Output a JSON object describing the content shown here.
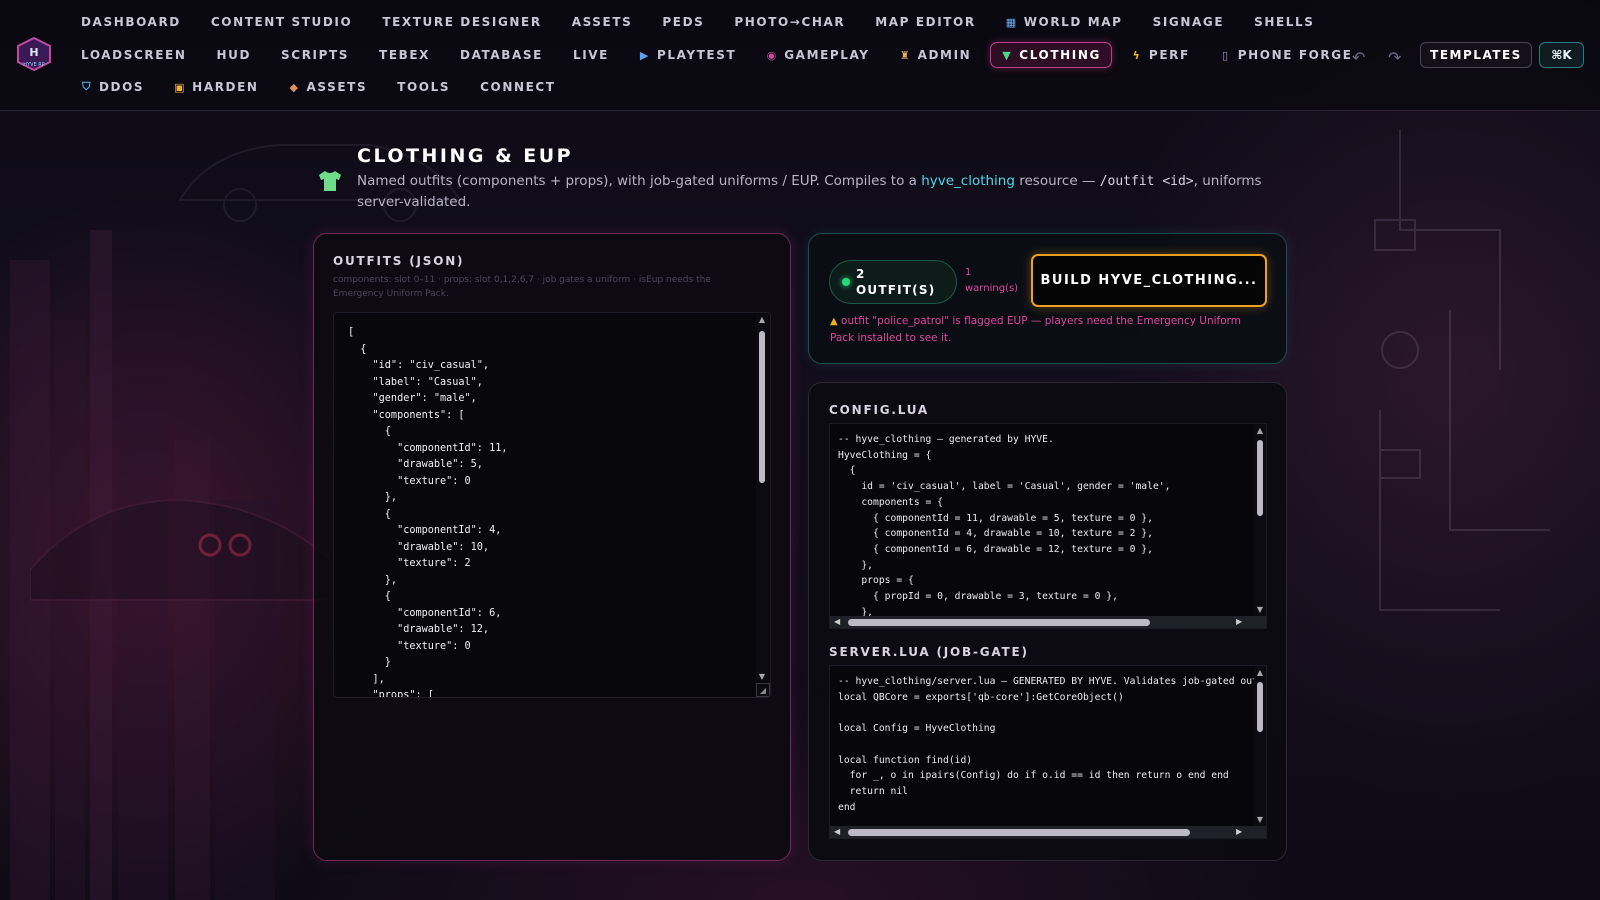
{
  "nav": {
    "logo_text": "HYVE RP",
    "row1": [
      {
        "label": "DASHBOARD",
        "icon": ""
      },
      {
        "label": "CONTENT STUDIO",
        "icon": ""
      },
      {
        "label": "TEXTURE DESIGNER",
        "icon": ""
      },
      {
        "label": "ASSETS",
        "icon": ""
      },
      {
        "label": "PEDS",
        "icon": ""
      },
      {
        "label": "PHOTO→CHAR",
        "icon": ""
      },
      {
        "label": "MAP EDITOR",
        "icon": ""
      },
      {
        "label": "WORLD MAP",
        "icon": "map-icon"
      },
      {
        "label": "SIGNAGE",
        "icon": ""
      },
      {
        "label": "SHELLS",
        "icon": ""
      }
    ],
    "row2": [
      {
        "label": "LOADSCREEN",
        "icon": ""
      },
      {
        "label": "HUD",
        "icon": ""
      },
      {
        "label": "SCRIPTS",
        "icon": ""
      },
      {
        "label": "TEBEX",
        "icon": ""
      },
      {
        "label": "DATABASE",
        "icon": ""
      },
      {
        "label": "LIVE",
        "icon": ""
      },
      {
        "label": "PLAYTEST",
        "icon": "play-icon"
      },
      {
        "label": "GAMEPLAY",
        "icon": "gameplay-icon"
      },
      {
        "label": "ADMIN",
        "icon": "admin-icon"
      },
      {
        "label": "CLOTHING",
        "icon": "shirt-icon",
        "active": true
      },
      {
        "label": "PERF",
        "icon": "lightning-icon"
      },
      {
        "label": "PHONE FORGE",
        "icon": "phone-icon"
      }
    ],
    "row3": [
      {
        "label": "DDOS",
        "icon": "shield-icon"
      },
      {
        "label": "HARDEN",
        "icon": "lock-icon"
      },
      {
        "label": "ASSETS",
        "icon": "box-icon"
      },
      {
        "label": "TOOLS",
        "icon": ""
      },
      {
        "label": "CONNECT",
        "icon": ""
      }
    ],
    "templates_label": "TEMPLATES",
    "cmdk_label": "⌘K"
  },
  "header": {
    "title": "CLOTHING & EUP",
    "desc_prefix": "Named outfits (components + props), with job-gated uniforms / EUP. Compiles to a ",
    "desc_resource": "hyve_clothing",
    "desc_middle": " resource — ",
    "desc_command": "/outfit <id>",
    "desc_suffix": ", uniforms server-validated."
  },
  "outfits": {
    "title": "OUTFITS (JSON)",
    "hint": "components: slot 0–11 · props: slot 0,1,2,6,7 · job gates a uniform · isEup needs the Emergency Uniform Pack.",
    "json": "[\n  {\n    \"id\": \"civ_casual\",\n    \"label\": \"Casual\",\n    \"gender\": \"male\",\n    \"components\": [\n      {\n        \"componentId\": 11,\n        \"drawable\": 5,\n        \"texture\": 0\n      },\n      {\n        \"componentId\": 4,\n        \"drawable\": 10,\n        \"texture\": 2\n      },\n      {\n        \"componentId\": 6,\n        \"drawable\": 12,\n        \"texture\": 0\n      }\n    ],\n    \"props\": ["
  },
  "build": {
    "count_label": "2 OUTFIT(S)",
    "warning_count": "1 warning(s)",
    "build_label": "BUILD HYVE_CLOTHING...",
    "warning_message": "outfit \"police_patrol\" is flagged EUP — players need the Emergency Uniform Pack installed to see it.",
    "status_color": "#26d97a",
    "accent_color": "#f0a020",
    "warning_color": "#e0479c"
  },
  "config": {
    "title": "CONFIG.LUA",
    "code": "-- hyve_clothing — generated by HYVE.\nHyveClothing = {\n  {\n    id = 'civ_casual', label = 'Casual', gender = 'male',\n    components = {\n      { componentId = 11, drawable = 5, texture = 0 },\n      { componentId = 4, drawable = 10, texture = 2 },\n      { componentId = 6, drawable = 12, texture = 0 },\n    },\n    props = {\n      { propId = 0, drawable = 3, texture = 0 },\n    },"
  },
  "server": {
    "title": "SERVER.LUA (JOB-GATE)",
    "code": "-- hyve_clothing/server.lua — GENERATED BY HYVE. Validates job-gated out\nlocal QBCore = exports['qb-core']:GetCoreObject()\n\nlocal Config = HyveClothing\n\nlocal function find(id)\n  for _, o in ipairs(Config) do if o.id == id then return o end end\n  return nil\nend"
  }
}
